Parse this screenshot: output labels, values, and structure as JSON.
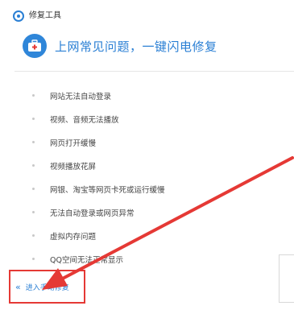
{
  "app": {
    "title": "修复工具",
    "icon": "repair-tool-icon"
  },
  "headline": {
    "icon": "first-aid-kit-icon",
    "text": "上网常见问题，一键闪电修复"
  },
  "issues": [
    {
      "label": "网站无法自动登录"
    },
    {
      "label": "视频、音频无法播放"
    },
    {
      "label": "网页打开缓慢"
    },
    {
      "label": "视频播放花屏"
    },
    {
      "label": "网银、淘宝等网页卡死或运行缓慢"
    },
    {
      "label": "无法自动登录或网页异常"
    },
    {
      "label": "虚拟内存问题"
    },
    {
      "label": "QQ空间无法正常显示"
    }
  ],
  "manual_entry": {
    "icon": "double-chevron-left-icon",
    "label": "进入手动修复"
  },
  "colors": {
    "accent": "#2a7fd4",
    "annotation": "#e53935"
  }
}
